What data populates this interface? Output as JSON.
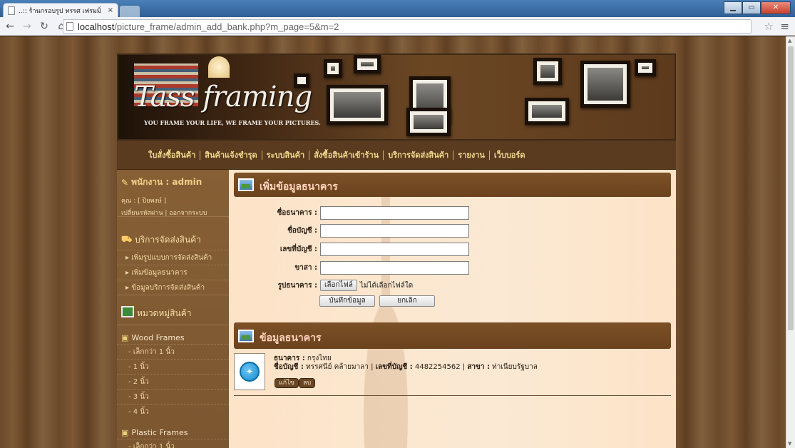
{
  "browser": {
    "tab_title": "..:: ร้านกรอบรูป ทรรศ เฟรมมิ่",
    "tab_close": "×",
    "url_host": "localhost",
    "url_path": "/picture_frame/admin_add_bank.php?m_page=5&m=2",
    "icons": {
      "back": "back-arrow-icon",
      "forward": "forward-arrow-icon",
      "reload": "reload-icon",
      "home": "home-icon",
      "star": "star-icon",
      "menu": "menu-icon"
    }
  },
  "banner": {
    "brand": "Tass framing",
    "slogan": "YOU FRAME YOUR LIFE, WE FRAME YOUR PICTURES."
  },
  "mainnav": [
    "ใบสั่งซื้อสินค้า",
    "สินค้าแจ้งชำรุด",
    "ระบบสินค้า",
    "สั่งซื้อสินค้าเข้าร้าน",
    "บริการจัดส่งสินค้า",
    "รายงาน",
    "เว็บบอร์ด"
  ],
  "sidebar": {
    "staff_label": "พนักงาน : admin",
    "user_line": "คุณ : [ ปิยพงษ์ ]",
    "account_links": "เปลี่ยนรหัสผ่าน | ออกจากระบบ",
    "shipping_head": "บริการจัดส่งสินค้า",
    "shipping_items": [
      "เพิ่มรูปแบบการจัดส่งสินค้า",
      "เพิ่มข้อมูลธนาคาร",
      "ข้อมูลบริการจัดส่งสินค้า"
    ],
    "category_head": "หมวดหมู่สินค้า",
    "categories": [
      {
        "name": "Wood Frames",
        "sizes": [
          "- เล็กกว่า 1 นิ้ว",
          "- 1 นิ้ว",
          "- 2 นิ้ว",
          "- 3 นิ้ว",
          "- 4 นิ้ว"
        ]
      },
      {
        "name": "Plastic Frames",
        "sizes": [
          "- เล็กกว่า 1 นิ้ว"
        ]
      }
    ]
  },
  "form": {
    "title": "เพิ่มข้อมูลธนาคาร",
    "bank_label": "ชื่อธนาคาร :",
    "account_name_label": "ชื่อบัญชี :",
    "account_no_label": "เลขที่บัญชี :",
    "branch_label": "ขาสา :",
    "image_label": "รูปธนาคาร :",
    "file_button": "เลือกไฟล์",
    "no_file": "ไม่ได้เลือกไฟล์ใด",
    "submit": "บันทึกข้อมูล",
    "cancel": "ยกเลิก",
    "values": {
      "bank": "",
      "account_name": "",
      "account_no": "",
      "branch": ""
    }
  },
  "banklist": {
    "title": "ข้อมูลธนาคาร",
    "items": [
      {
        "bank_line_label": "ธนาคาร :",
        "bank": "กรุงไทย",
        "acc_name_label": "ชื่อบัญชี :",
        "acc_name": "ทรรศนีย์ คล้ายมาลา",
        "acc_no_label": "เลขที่บัญชี :",
        "acc_no": "4482254562",
        "branch_label": "สาขา :",
        "branch": "ท่าเนียบรัฐบาล",
        "edit": "แก้ไข",
        "delete": "ลบ"
      }
    ]
  }
}
